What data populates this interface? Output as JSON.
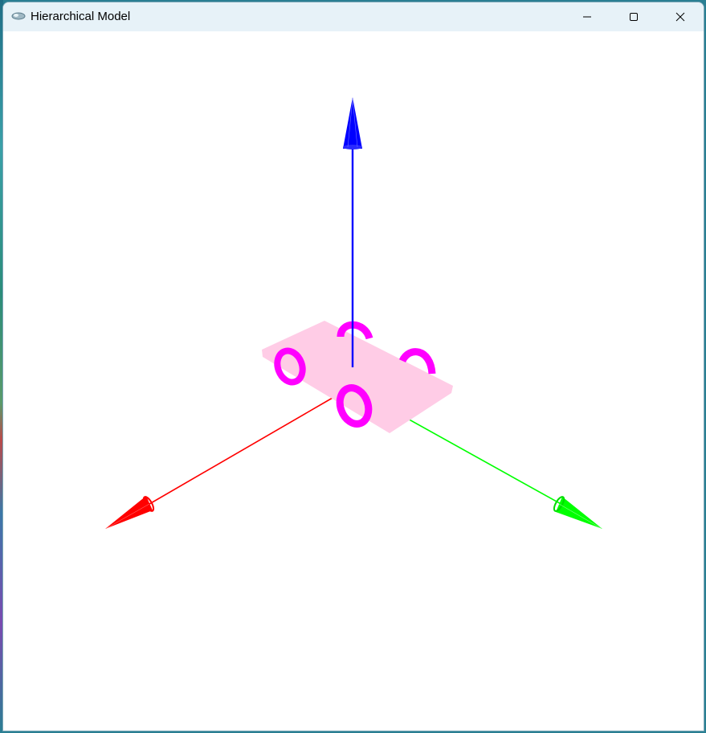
{
  "window": {
    "title": "Hierarchical Model",
    "app_icon": "opengl-app-icon",
    "controls": {
      "minimize_icon": "minimize-icon",
      "maximize_icon": "maximize-icon",
      "close_icon": "close-icon"
    }
  },
  "scene": {
    "background": "#ffffff",
    "axes": {
      "x_color": "#ff0000",
      "y_color": "#00ff00",
      "z_color": "#0000ff"
    },
    "car": {
      "body_color": "#ffcce6",
      "wheel_color": "#ff00ff",
      "wheel_count": 4
    }
  }
}
